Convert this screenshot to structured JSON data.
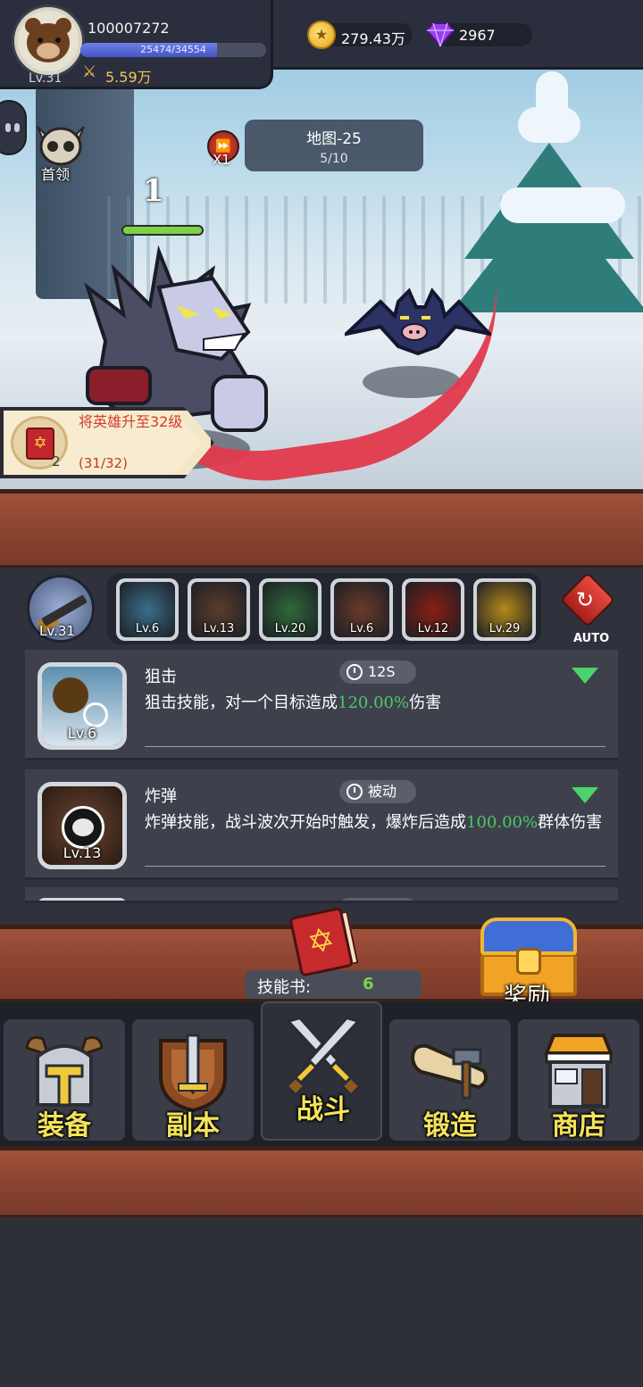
{
  "player": {
    "id": "100007272",
    "level": "Lv.31",
    "exp_text": "25474/34554",
    "exp_fraction": 0.737,
    "power": "5.59万"
  },
  "resources": {
    "gold": "279.43万",
    "gems": "2967"
  },
  "battle": {
    "boss_label": "首领",
    "speed_label": "X1",
    "map_title": "地图-25",
    "wave": "5/10",
    "damage_number": "1",
    "enemy_hp_fraction": 1.0
  },
  "quest": {
    "text": "将英雄升至32级",
    "reward_count": "2",
    "progress": "(31/32)"
  },
  "weapon": {
    "level": "Lv.31"
  },
  "skill_slots": [
    {
      "level": "Lv.6",
      "icon": "sniper-icon",
      "color": "#3b6f8a"
    },
    {
      "level": "Lv.13",
      "icon": "bomb-icon",
      "color": "#5a3d2c"
    },
    {
      "level": "Lv.20",
      "icon": "poison-icon",
      "color": "#2f6b3a"
    },
    {
      "level": "Lv.6",
      "icon": "beast-icon",
      "color": "#6a3a2a"
    },
    {
      "level": "Lv.12",
      "icon": "fireball-icon",
      "color": "#8a1f12"
    },
    {
      "level": "Lv.29",
      "icon": "lightning-icon",
      "color": "#b48a1a"
    }
  ],
  "auto_label": "AUTO",
  "skills": [
    {
      "name": "狙击",
      "cooldown": "12S",
      "icon_level": "Lv.6",
      "desc_before": "狙击技能，对一个目标造成",
      "desc_highlight": "120.00%",
      "desc_after": "伤害"
    },
    {
      "name": "炸弹",
      "cooldown": "被动",
      "icon_level": "Lv.13",
      "desc_before": "炸弹技能，战斗波次开始时触发，爆炸后造成",
      "desc_highlight": "100.00%",
      "desc_after": "群体伤害"
    }
  ],
  "skill_book": {
    "label": "技能书:",
    "count": "6"
  },
  "reward_label": "奖励",
  "nav": [
    {
      "label": "装备",
      "icon": "helmet-icon"
    },
    {
      "label": "副本",
      "icon": "sword-shield-icon"
    },
    {
      "label": "战斗",
      "icon": "crossed-swords-icon"
    },
    {
      "label": "锻造",
      "icon": "hammer-scroll-icon"
    },
    {
      "label": "商店",
      "icon": "shop-icon"
    }
  ],
  "colors": {
    "highlight_green": "#4cc86a",
    "gold_text": "#f4e25a",
    "wood": "#8c4430"
  }
}
